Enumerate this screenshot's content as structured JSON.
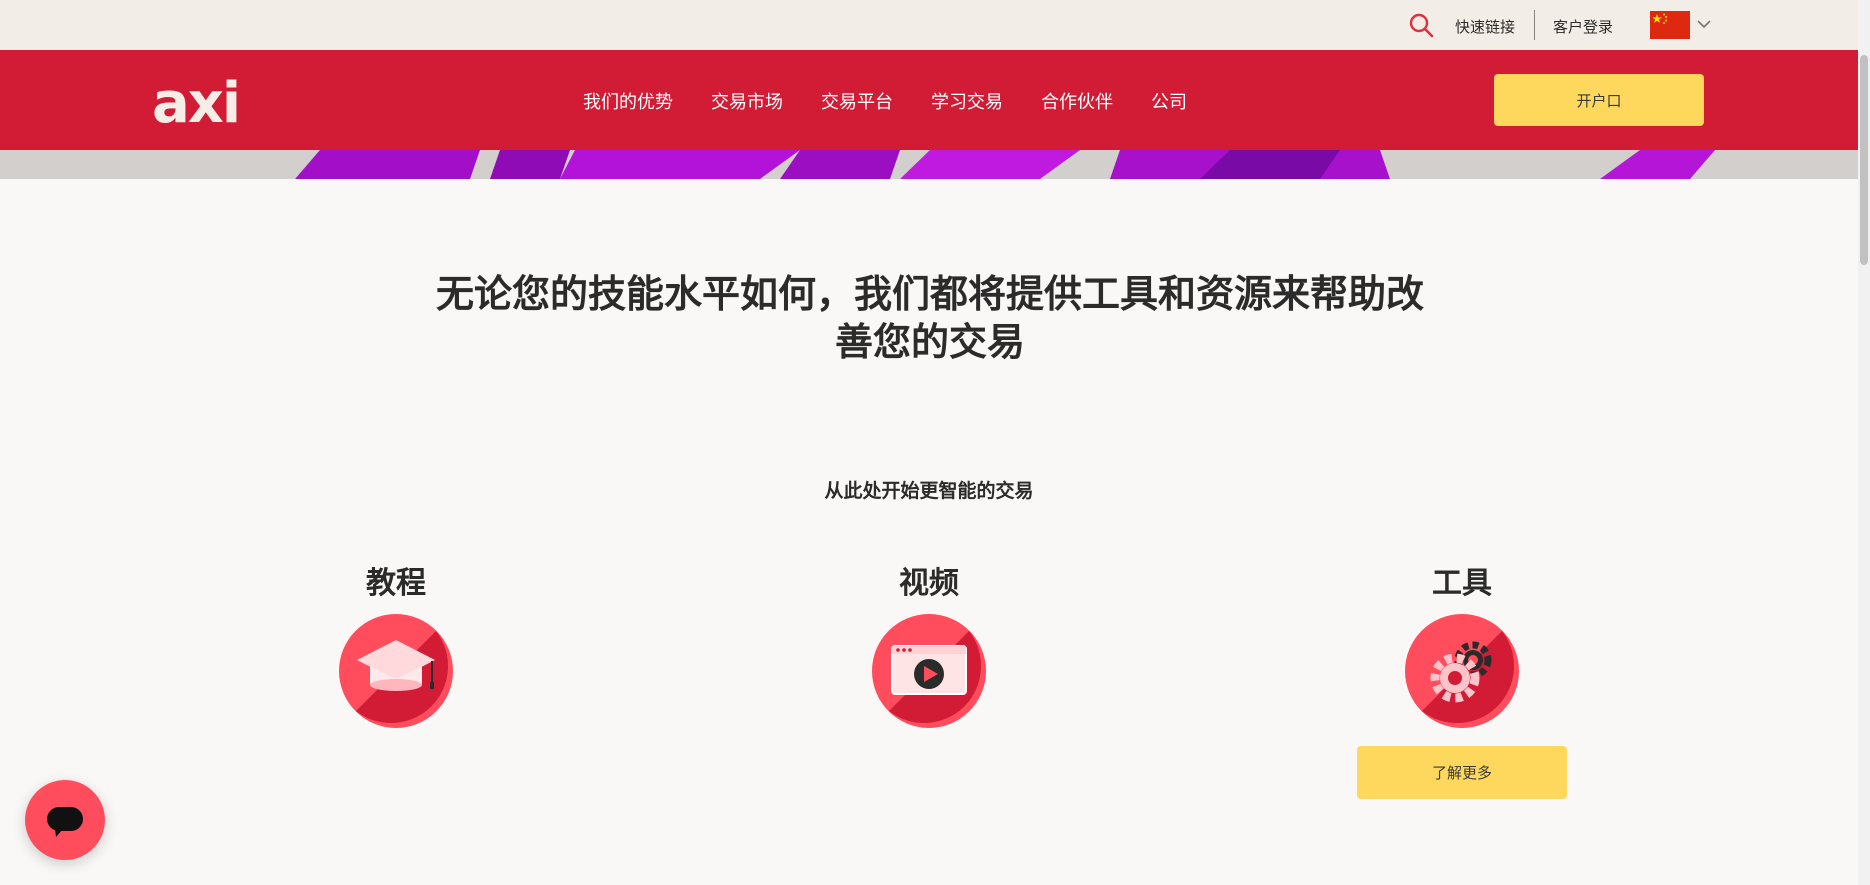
{
  "utility": {
    "search_icon": "search-icon",
    "quick_links": "快速链接",
    "client_login": "客户登录",
    "language_flag": "china-flag-icon"
  },
  "nav": {
    "logo": "axi",
    "items": [
      {
        "label": "我们的优势"
      },
      {
        "label": "交易市场"
      },
      {
        "label": "交易平台"
      },
      {
        "label": "学习交易"
      },
      {
        "label": "合作伙伴"
      },
      {
        "label": "公司"
      }
    ],
    "open_account": "开户口"
  },
  "hero": {
    "headline_line1": "无论您的技能水平如何，我们都将提供工具和资源来帮助改",
    "headline_line2": "善您的交易",
    "subheadline": "从此处开始更智能的交易"
  },
  "features": [
    {
      "title": "教程",
      "icon": "graduation-cap-icon"
    },
    {
      "title": "视频",
      "icon": "video-play-icon"
    },
    {
      "title": "工具",
      "icon": "gear-icon"
    }
  ],
  "learn_more": "了解更多",
  "colors": {
    "brand_red": "#d21c36",
    "accent_yellow": "#fdd85d",
    "icon_red": "#ff4d5e"
  }
}
